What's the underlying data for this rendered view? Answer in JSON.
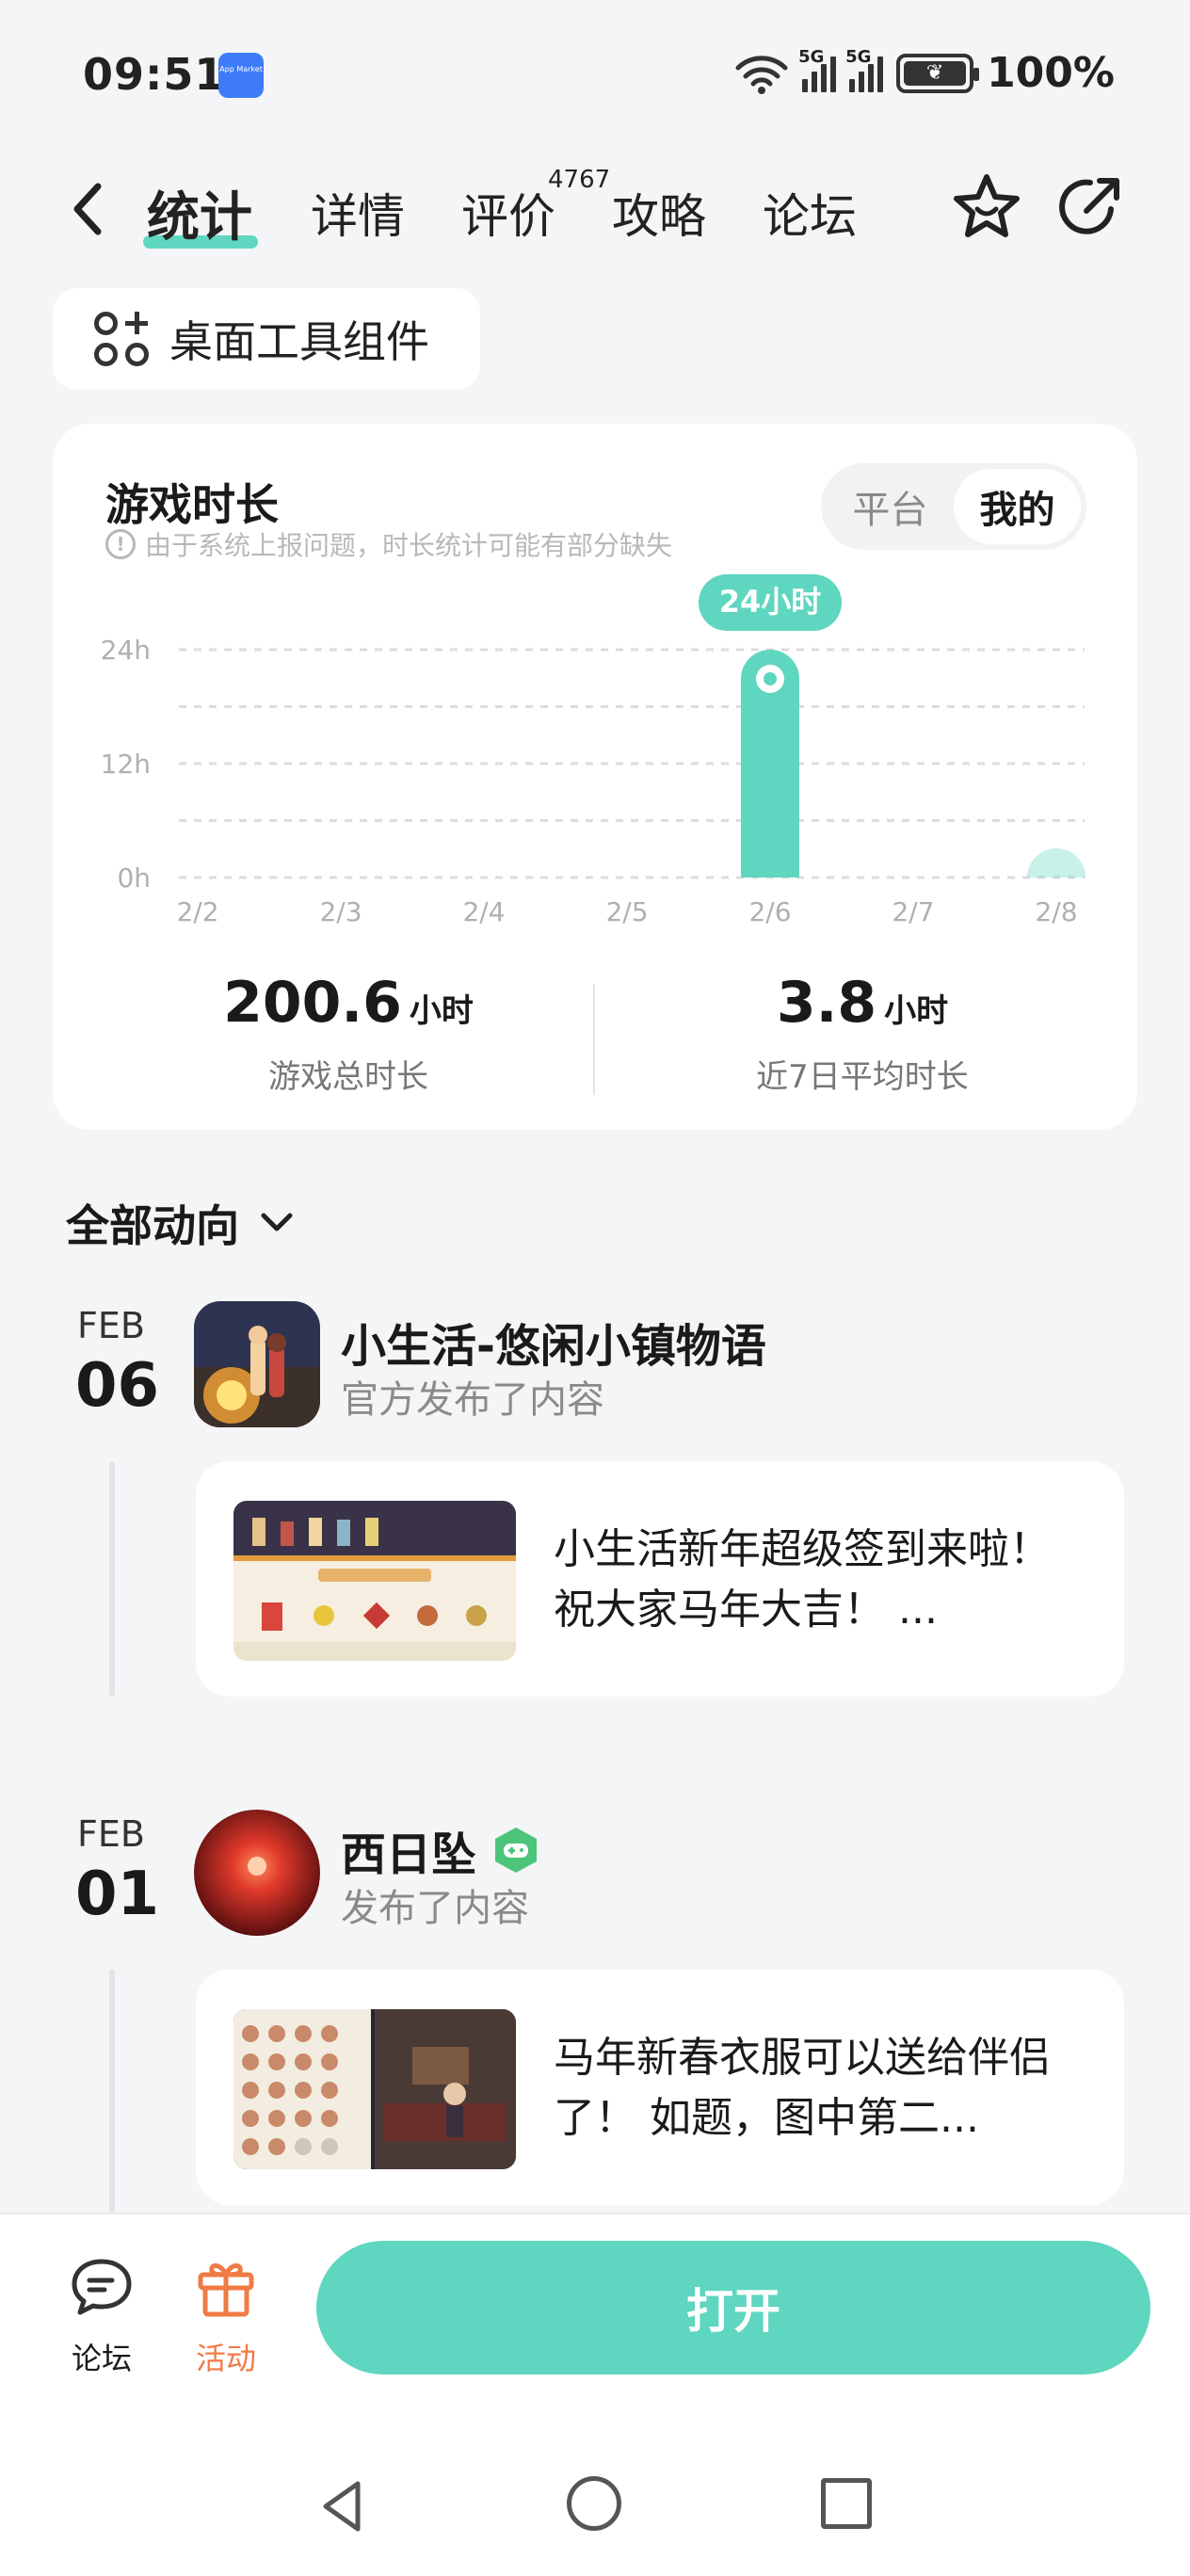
{
  "status_bar": {
    "time": "09:51",
    "app_icon_label": "App Market",
    "network_1": "5G",
    "network_2": "5G",
    "battery": "100%"
  },
  "nav": {
    "tabs": [
      "统计",
      "详情",
      "评价",
      "攻略",
      "论坛"
    ],
    "active_tab": "统计",
    "review_count": "4767"
  },
  "widget_button": {
    "label": "桌面工具组件"
  },
  "stats": {
    "title": "游戏时长",
    "note": "由于系统上报问题，时长统计可能有部分缺失",
    "toggle": [
      "平台",
      "我的"
    ],
    "toggle_active": "我的",
    "tooltip": "24小时",
    "total_value": "200.6",
    "total_unit": "小时",
    "total_label": "游戏总时长",
    "avg_value": "3.8",
    "avg_unit": "小时",
    "avg_label": "近7日平均时长"
  },
  "chart_data": {
    "type": "bar",
    "categories": [
      "2/2",
      "2/3",
      "2/4",
      "2/5",
      "2/6",
      "2/7",
      "2/8"
    ],
    "values": [
      0,
      0,
      0,
      0,
      24,
      0,
      0.5
    ],
    "y_ticks": [
      "24h",
      "12h",
      "0h"
    ],
    "ylim": [
      0,
      24
    ],
    "grid": true,
    "color": "#5fd6bf"
  },
  "feed": {
    "header": "全部动向",
    "entries": [
      {
        "month": "FEB",
        "day": "06",
        "title": "小生活-悠闲小镇物语",
        "subtitle": "官方发布了内容",
        "post_text": "小生活新年超级签到来啦！祝大家马年大吉！ ..."
      },
      {
        "month": "FEB",
        "day": "01",
        "title": "西日坠",
        "subtitle": "发布了内容",
        "post_text": "马年新春衣服可以送给伴侣了！ 如题，图中第二..."
      }
    ]
  },
  "bottom_bar": {
    "forum_label": "论坛",
    "activity_label": "活动",
    "open_label": "打开"
  },
  "colors": {
    "accent": "#5fd6bf",
    "activity": "#f07b45"
  }
}
